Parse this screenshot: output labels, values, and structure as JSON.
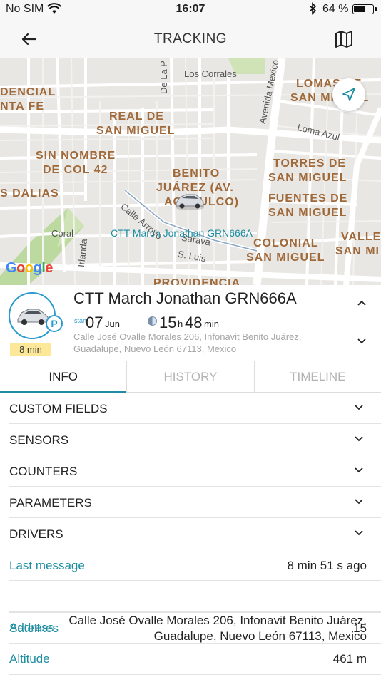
{
  "status_bar": {
    "carrier": "No SIM",
    "time": "16:07",
    "battery_pct": "64 %",
    "battery_level": 0.64
  },
  "nav": {
    "title": "TRACKING"
  },
  "map": {
    "areas": [
      "DENCIAL",
      "NTA FE",
      "REAL DE",
      "SAN MIGUEL",
      "SIN NOMBRE",
      "DE COL 42",
      "S DALIAS",
      "BENITO",
      "JUÁREZ (AV.",
      "ACAPULCO)",
      "LOMAS DE",
      "SAN MIGUEL",
      "TORRES DE",
      "SAN MIGUEL",
      "FUENTES DE",
      "SAN MIGUEL",
      "COLONIAL",
      "SAN MIGUEL",
      "VALLE",
      "SAN MI",
      "PROVIDENCIA"
    ],
    "streets": [
      "Los Corrales",
      "Avenida Mexico",
      "Loma Azul",
      "Calle Arroyo",
      "Coral",
      "Irlanda",
      "Sarava",
      "S. Luis",
      "De La P"
    ],
    "vehicle_label": "CTT March Jonathan GRN666A",
    "attribution": "Google"
  },
  "vehicle": {
    "name": "CTT March Jonathan GRN666A",
    "age_badge": "8 min",
    "parking_icon": "P",
    "start_label": "start",
    "start_day": "07",
    "start_month": "Jun",
    "duration_hours": "15",
    "duration_hours_unit": "h",
    "duration_minutes": "48",
    "duration_minutes_unit": "min",
    "address_line1": "Calle José Ovalle Morales 206, Infonavit Benito Juárez,",
    "address_line2": "Guadalupe, Nuevo León 67113, Mexico"
  },
  "tabs": [
    "INFO",
    "HISTORY",
    "TIMELINE"
  ],
  "sections": [
    "CUSTOM FIELDS",
    "SENSORS",
    "COUNTERS",
    "PARAMETERS",
    "DRIVERS"
  ],
  "info": {
    "last_message_label": "Last message",
    "last_message_value": "8 min 51 s ago",
    "address_label": "Address",
    "address_line1": "Calle José Ovalle Morales 206, Infonavit Benito Juárez,",
    "address_line2": "Guadalupe, Nuevo León 67113, Mexico",
    "satellites_label": "Satellites",
    "satellites_value": "15",
    "altitude_label": "Altitude",
    "altitude_value": "461 m"
  },
  "colors": {
    "accent": "#1e8da0",
    "icon_blue": "#2a9ad0",
    "badge_yellow": "#fde89a",
    "map_area_label": "#a0693a"
  },
  "icons": [
    "wifi-icon",
    "bluetooth-icon",
    "battery-icon",
    "back-arrow-icon",
    "map-icon",
    "locate-icon",
    "car-icon",
    "parking-icon",
    "duration-icon",
    "chevron-up-icon",
    "chevron-down-icon"
  ]
}
